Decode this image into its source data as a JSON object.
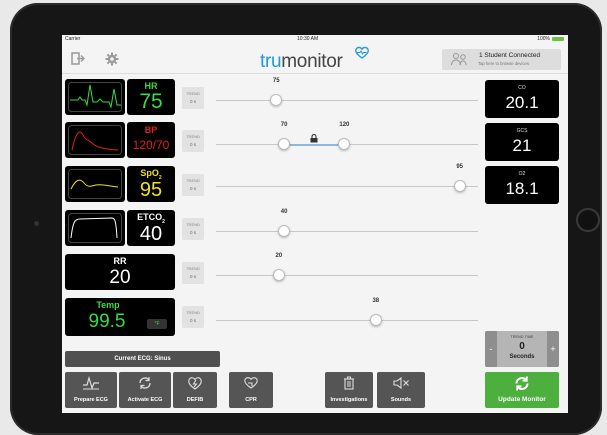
{
  "status": {
    "carrier": "Carrier",
    "time": "10:30 AM",
    "battery": "100%"
  },
  "header": {
    "logo_a": "tru",
    "logo_b": "monitor",
    "connection_main": "1 Student Connected",
    "connection_sub": "Tap here to browse devices"
  },
  "vitals": [
    {
      "name": "HR",
      "value": "75",
      "trend_label": "TREND",
      "trend_value": "0 s",
      "color": "#33dd44",
      "slider_values": [
        "75"
      ],
      "slider_levels": [
        0.23
      ]
    },
    {
      "name": "BP",
      "value": "120/70",
      "trend_label": "TREND",
      "trend_value": "0 s",
      "color": "#e02020",
      "slider_values": [
        "70",
        "120"
      ],
      "slider_levels": [
        0.26,
        0.49
      ]
    },
    {
      "name": "SpO",
      "name_sub": "2",
      "value": "95",
      "trend_label": "TREND",
      "trend_value": "0 s",
      "color": "#f0e020",
      "slider_values": [
        "95"
      ],
      "slider_levels": [
        0.93
      ]
    },
    {
      "name": "ETCO",
      "name_sub": "2",
      "value": "40",
      "trend_label": "TREND",
      "trend_value": "0 s",
      "color": "#ffffff",
      "slider_values": [
        "40"
      ],
      "slider_levels": [
        0.26
      ]
    },
    {
      "name": "RR",
      "value": "20",
      "trend_label": "TREND",
      "trend_value": "0 s",
      "color": "#ffffff",
      "slider_values": [
        "20"
      ],
      "slider_levels": [
        0.24
      ]
    },
    {
      "name": "Temp",
      "value": "99.5",
      "unit": "°F",
      "trend_label": "TREND",
      "trend_value": "0 s",
      "color": "#33dd44",
      "slider_values": [
        "38"
      ],
      "slider_levels": [
        0.61
      ]
    }
  ],
  "right_tiles": [
    {
      "label": "CO",
      "value": "20.1"
    },
    {
      "label": "GCS",
      "value": "21"
    },
    {
      "label": "O2",
      "value": "18.1"
    }
  ],
  "current_ecg": "Current ECG: Sinus",
  "trend_time": {
    "label": "TREND TIME",
    "value": "0",
    "unit": "Seconds",
    "minus": "-",
    "plus": "+"
  },
  "buttons": [
    {
      "label": "Prepare ECG",
      "icon": "ecg-icon"
    },
    {
      "label": "Activate ECG",
      "icon": "refresh-icon"
    },
    {
      "label": "DEFIB",
      "icon": "heart-bolt-icon"
    },
    {
      "label": "CPR",
      "icon": "heart-hand-icon"
    },
    {
      "label": "Investigations",
      "icon": "trash-icon"
    },
    {
      "label": "Sounds",
      "icon": "speaker-mute-icon"
    }
  ],
  "update_button": {
    "label": "Update Monitor",
    "icon": "sync-icon"
  },
  "colors": {
    "green": "#4caf3e",
    "accent": "#1f9bd6",
    "tile": "#000000"
  }
}
